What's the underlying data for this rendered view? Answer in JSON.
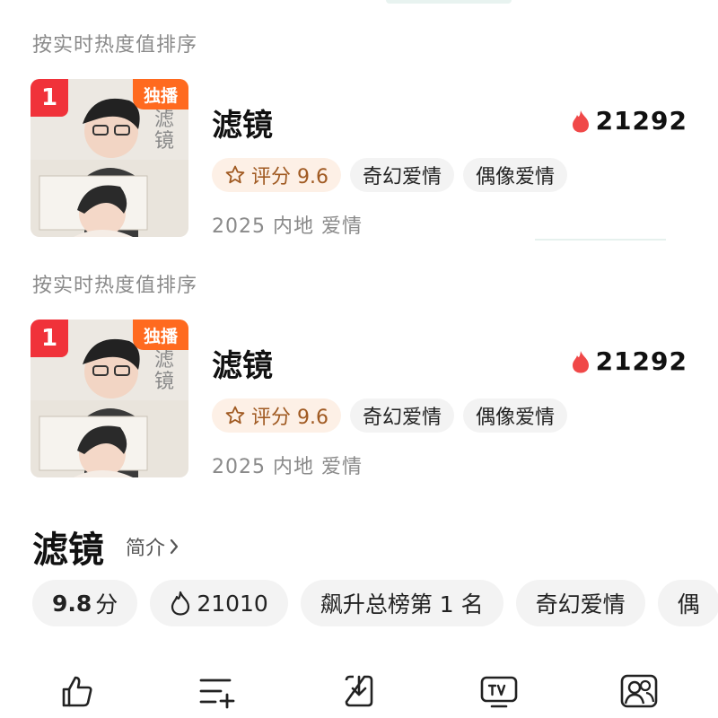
{
  "sort_label": "按实时热度值排序",
  "cards": [
    {
      "rank": "1",
      "exclusive": "独播",
      "title": "滤镜",
      "heat": "21292",
      "score_label": "评分 9.6",
      "tags": [
        "奇幻爱情",
        "偶像爱情"
      ],
      "meta": "2025 内地 爱情"
    },
    {
      "rank": "1",
      "exclusive": "独播",
      "title": "滤镜",
      "heat": "21292",
      "score_label": "评分 9.6",
      "tags": [
        "奇幻爱情",
        "偶像爱情"
      ],
      "meta": "2025 内地 爱情"
    }
  ],
  "detail": {
    "title": "滤镜",
    "intro_label": "简介",
    "chips": {
      "score_value": "9.8",
      "score_unit": "分",
      "heat": "21010",
      "rank_text": "飙升总榜第 1 名",
      "genre": "奇幻爱情",
      "overflow": "偶"
    }
  },
  "poster_text": "滤镜",
  "icons": {
    "flame": "flame-icon",
    "star": "star-outline-icon",
    "chevron": "chevron-right-icon",
    "like": "thumbs-up-icon",
    "add_list": "add-to-playlist-icon",
    "download": "download-icon",
    "tv": "tv-cast-icon",
    "watch_together": "watch-together-icon"
  },
  "colors": {
    "rank_red": "#f0323a",
    "exclusive_orange": "#ff6a1f",
    "flame_red": "#f04848",
    "score_bg": "#fdf0e6",
    "score_text": "#a05a22"
  }
}
